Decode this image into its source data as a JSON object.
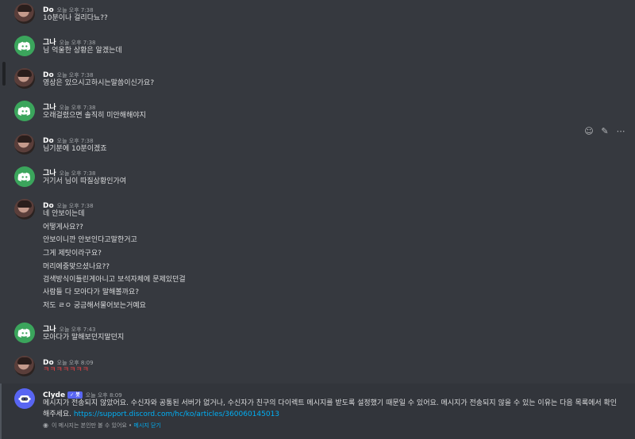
{
  "messages": [
    {
      "user": "Do",
      "avatar": "user-photo-avatar",
      "time": "오늘 오후 7:38",
      "lines": [
        "10분이나 걸리다뇨??"
      ]
    },
    {
      "user": "그나",
      "avatar": "discord-logo-avatar",
      "time": "오늘 오후 7:38",
      "lines": [
        "님 억울한 상황은 알겠는데"
      ]
    },
    {
      "user": "Do",
      "avatar": "user-photo-avatar",
      "time": "오늘 오후 7:38",
      "lines": [
        "영상은 있으시고하시는말씀이신가요?"
      ]
    },
    {
      "user": "그나",
      "avatar": "discord-logo-avatar",
      "time": "오늘 오후 7:38",
      "lines": [
        "오래걸렸으면 솔직히 미안해해야지"
      ]
    },
    {
      "user": "Do",
      "avatar": "user-photo-avatar",
      "time": "오늘 오후 7:38",
      "lines": [
        "님기분에 10분이겠죠"
      ]
    },
    {
      "user": "그나",
      "avatar": "discord-logo-avatar",
      "time": "오늘 오후 7:38",
      "lines": [
        "거기서 님이 따질상황인가여"
      ]
    },
    {
      "user": "Do",
      "avatar": "user-photo-avatar",
      "time": "오늘 오후 7:38",
      "lines": [
        "네 안보이는데",
        "어떻게사요??",
        "안보이니깐 안보인다고말한거고",
        "그게 제탓이라구요?",
        "머리에중맞으셨나요??",
        "검색방식이틀린게아니고 보석자체에 문제있던걸",
        "사람들 다 모아다가 말해볼까요?",
        "저도 ㄹㅇ 궁금해서물어보는거예요"
      ]
    },
    {
      "user": "그나",
      "avatar": "discord-logo-avatar",
      "time": "오늘 오후 7:43",
      "lines": [
        "모아다가 말해보던지말던지"
      ]
    },
    {
      "user": "Do",
      "avatar": "user-photo-avatar",
      "time": "오늘 오후 8:09",
      "lines": [
        "ㅋㅋㅋㅋㅋㅋㅋ"
      ]
    }
  ],
  "clyde": {
    "user": "Clyde",
    "badge": "✓ 봇",
    "time": "오늘 오후 8:09",
    "text": "메시지가 전송되지 않았어요. 수신자와 공통된 서버가 없거나, 수신자가 친구의 다이렉트 메시지를 받도록 설정했기 때문일 수 있어요. 메시지가 전송되지 않을 수 있는 이유는 다음 목록에서 확인해주세요. ",
    "link": "https://support.discord.com/hc/ko/articles/360060145013",
    "ephemeral_note": "이 메시지는 본인만 볼 수 있어요 • ",
    "dismiss": "메시지 닫기"
  },
  "hover_tools": [
    "add-reaction-icon",
    "edit-icon",
    "more-icon"
  ],
  "colors": {
    "background": "#36393f",
    "green_avatar": "#3ba55c",
    "blurple": "#5865f2",
    "link": "#00aff4",
    "red_text": "#ed4245"
  }
}
